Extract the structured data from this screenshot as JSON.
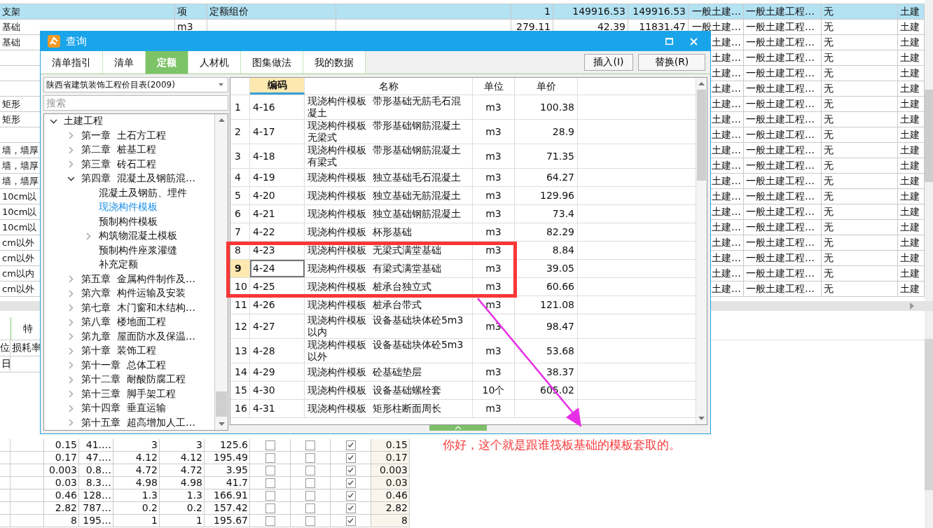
{
  "sheet": {
    "rows": [
      {
        "selected": true,
        "desc": "支架",
        "unit": "项",
        "name": "定额组价",
        "qty": "1",
        "price": "149916.53",
        "total": "149916.53",
        "c1": "一般土建…",
        "c2": "一般土建工程…",
        "c3": "无",
        "c4": "土建"
      },
      {
        "selected": false,
        "desc": "基础",
        "unit": "m3",
        "qty": "279.11",
        "price": "42.39",
        "total": "11831.47",
        "c1": "一般土建…",
        "c2": "一般土建工程…",
        "c3": "无",
        "c4": "土建"
      },
      {
        "selected": false,
        "desc": "基础",
        "c1": "土建…",
        "c2": "一般土建工程…",
        "c3": "无",
        "c4": "土建"
      },
      {
        "selected": false,
        "c1": "土建…",
        "c2": "一般土建工程…",
        "c3": "无",
        "c4": "土建"
      },
      {
        "selected": false,
        "c1": "土建…",
        "c2": "一般土建工程…",
        "c3": "无",
        "c4": "土建"
      },
      {
        "selected": false,
        "c1": "土建…",
        "c2": "一般土建工程…",
        "c3": "无",
        "c4": "土建"
      },
      {
        "selected": false,
        "desc": "矩形",
        "c1": "土建…",
        "c2": "一般土建工程…",
        "c3": "无",
        "c4": "土建"
      },
      {
        "selected": false,
        "desc": "矩形",
        "c1": "土建…",
        "c2": "一般土建工程…",
        "c3": "无",
        "c4": "土建"
      },
      {
        "selected": false,
        "c1": "土建…",
        "c2": "一般土建工程…",
        "c3": "无",
        "c4": "土建"
      },
      {
        "selected": false,
        "desc": "墙，墙厚",
        "c1": "土建…",
        "c2": "一般土建工程…",
        "c3": "无",
        "c4": "土建"
      },
      {
        "selected": false,
        "desc": "墙，墙厚",
        "c1": "土建…",
        "c2": "一般土建工程…",
        "c3": "无",
        "c4": "土建"
      },
      {
        "selected": false,
        "desc": "墙，墙厚",
        "c1": "土建…",
        "c2": "一般土建工程…",
        "c3": "无",
        "c4": "土建"
      },
      {
        "selected": false,
        "desc": "10cm以",
        "c1": "土建…",
        "c2": "一般土建工程…",
        "c3": "无",
        "c4": "土建"
      },
      {
        "selected": false,
        "desc": "10cm以",
        "c1": "土建…",
        "c2": "一般土建工程…",
        "c3": "无",
        "c4": "土建"
      },
      {
        "selected": false,
        "desc": "10cm以",
        "c1": "土建…",
        "c2": "一般土建工程…",
        "c3": "无",
        "c4": "土建"
      },
      {
        "selected": false,
        "desc": "cm以外",
        "c1": "土建…",
        "c2": "一般土建工程…",
        "c3": "无",
        "c4": "土建"
      },
      {
        "selected": false,
        "desc": "cm以外",
        "c1": "土建…",
        "c2": "一般土建工程…",
        "c3": "无",
        "c4": "土建"
      },
      {
        "selected": false,
        "desc": "cm以内",
        "c1": "土建…",
        "c2": "一般土建工程…",
        "c3": "无",
        "c4": "土建"
      },
      {
        "selected": false,
        "desc": "cm以外",
        "c1": "土建…",
        "c2": "一般土建工程…",
        "c3": "无",
        "c4": "土建"
      }
    ]
  },
  "lower": {
    "tab": "特",
    "headers": [
      "位",
      "损耗率"
    ],
    "first_row": "日",
    "rows": [
      {
        "column_3": "0.15",
        "column_4": "41.…",
        "column_5": "3",
        "column_6": "3",
        "column_7": "125.6",
        "check_1": false,
        "check_2": false,
        "check_3": true,
        "column_11": "0.15"
      },
      {
        "column_3": "0.17",
        "column_4": "47.…",
        "column_5": "4.12",
        "column_6": "4.12",
        "column_7": "195.49",
        "check_1": false,
        "check_2": false,
        "check_3": true,
        "column_11": "0.17"
      },
      {
        "column_3": "0.003",
        "column_4": "0.8…",
        "column_5": "4.72",
        "column_6": "4.72",
        "column_7": "3.95",
        "check_1": false,
        "check_2": false,
        "check_3": true,
        "column_11": "0.003"
      },
      {
        "column_3": "0.03",
        "column_4": "8.3…",
        "column_5": "4.98",
        "column_6": "4.98",
        "column_7": "41.7",
        "check_1": false,
        "check_2": false,
        "check_3": true,
        "column_11": "0.03"
      },
      {
        "column_3": "0.46",
        "column_4": "128…",
        "column_5": "1.3",
        "column_6": "1.3",
        "column_7": "166.91",
        "check_1": false,
        "check_2": false,
        "check_3": true,
        "column_11": "0.46"
      },
      {
        "column_3": "2.82",
        "column_4": "787…",
        "column_5": "0.2",
        "column_6": "0.2",
        "column_7": "157.42",
        "check_1": false,
        "check_2": false,
        "check_3": true,
        "column_11": "2.82"
      },
      {
        "column_3": "8",
        "column_4": "195…",
        "column_5": "1",
        "column_6": "1",
        "column_7": "195.67",
        "check_1": false,
        "check_2": false,
        "check_3": true,
        "column_11": "8"
      }
    ]
  },
  "dialog": {
    "title": "查询",
    "tabs": [
      {
        "label": "清单指引",
        "selected": false
      },
      {
        "label": "清单",
        "selected": false
      },
      {
        "label": "定额",
        "selected": true
      },
      {
        "label": "人材机",
        "selected": false
      },
      {
        "label": "图集做法",
        "selected": false
      },
      {
        "label": "我的数据",
        "selected": false
      }
    ],
    "buttons": [
      "插入(I)",
      "替换(R)"
    ],
    "library": "陕西省建筑装饰工程价目表(2009)",
    "search": {
      "placeholder": "搜索"
    },
    "tree": [
      {
        "label": "土建工程",
        "kind": "branch",
        "expanded": true,
        "selected": false,
        "children": [
          {
            "label": "第一章  土石方工程",
            "kind": "branch",
            "expanded": false,
            "selected": false
          },
          {
            "label": "第二章  桩基工程",
            "kind": "branch",
            "expanded": false,
            "selected": false
          },
          {
            "label": "第三章  砖石工程",
            "kind": "branch",
            "expanded": false,
            "selected": false
          },
          {
            "label": "第四章  混凝土及钢筋混…",
            "kind": "branch",
            "expanded": true,
            "selected": false,
            "children": [
              {
                "label": "混凝土及钢筋、埋件",
                "kind": "leaf",
                "selected": false
              },
              {
                "label": "现浇构件模板",
                "kind": "leaf",
                "selected": true
              },
              {
                "label": "预制构件模板",
                "kind": "leaf",
                "selected": false
              },
              {
                "label": "构筑物混凝土模板",
                "kind": "branch",
                "expanded": false,
                "selected": false
              },
              {
                "label": "预制构件座浆灌缝",
                "kind": "leaf",
                "selected": false
              },
              {
                "label": "补充定额",
                "kind": "leaf",
                "selected": false
              }
            ]
          },
          {
            "label": "第五章  金属构件制作及…",
            "kind": "branch",
            "expanded": false,
            "selected": false
          },
          {
            "label": "第六章  构件运输及安装",
            "kind": "branch",
            "expanded": false,
            "selected": false
          },
          {
            "label": "第七章  木门窗和木结构…",
            "kind": "branch",
            "expanded": false,
            "selected": false
          },
          {
            "label": "第八章  楼地面工程",
            "kind": "branch",
            "expanded": false,
            "selected": false
          },
          {
            "label": "第九章  屋面防水及保温…",
            "kind": "branch",
            "expanded": false,
            "selected": false
          },
          {
            "label": "第十章  装饰工程",
            "kind": "branch",
            "expanded": false,
            "selected": false
          },
          {
            "label": "第十一章  总体工程",
            "kind": "branch",
            "expanded": false,
            "selected": false
          },
          {
            "label": "第十二章  耐酸防腐工程",
            "kind": "branch",
            "expanded": false,
            "selected": false
          },
          {
            "label": "第十三章  脚手架工程",
            "kind": "branch",
            "expanded": false,
            "selected": false
          },
          {
            "label": "第十四章  垂直运输",
            "kind": "branch",
            "expanded": false,
            "selected": false
          },
          {
            "label": "第十五章  超高增加人工…",
            "kind": "branch",
            "expanded": false,
            "selected": false
          }
        ]
      }
    ],
    "table": {
      "columns": [
        "编码",
        "名称",
        "单位",
        "单价"
      ],
      "rows": [
        {
          "num": "1",
          "code": "4-16",
          "name": "现浇构件模板  带形基础无筋毛石混凝土",
          "unit": "m3",
          "price": "100.38",
          "selected": false
        },
        {
          "num": "2",
          "code": "4-17",
          "name": "现浇构件模板  带形基础钢筋混凝土无梁式",
          "unit": "m3",
          "price": "28.9",
          "selected": false
        },
        {
          "num": "3",
          "code": "4-18",
          "name": "现浇构件模板  带形基础钢筋混凝土有梁式",
          "unit": "m3",
          "price": "71.35",
          "selected": false
        },
        {
          "num": "4",
          "code": "4-19",
          "name": "现浇构件模板  独立基础毛石混凝土",
          "unit": "m3",
          "price": "64.27",
          "selected": false
        },
        {
          "num": "5",
          "code": "4-20",
          "name": "现浇构件模板  独立基础无筋混凝土",
          "unit": "m3",
          "price": "129.96",
          "selected": false
        },
        {
          "num": "6",
          "code": "4-21",
          "name": "现浇构件模板  独立基础钢筋混凝土",
          "unit": "m3",
          "price": "73.4",
          "selected": false
        },
        {
          "num": "7",
          "code": "4-22",
          "name": "现浇构件模板  杯形基础",
          "unit": "m3",
          "price": "82.29",
          "selected": false
        },
        {
          "num": "8",
          "code": "4-23",
          "name": "现浇构件模板  无梁式满堂基础",
          "unit": "m3",
          "price": "8.84",
          "selected": false
        },
        {
          "num": "9",
          "code": "4-24",
          "name": "现浇构件模板  有梁式满堂基础",
          "unit": "m3",
          "price": "39.05",
          "selected": true
        },
        {
          "num": "10",
          "code": "4-25",
          "name": "现浇构件模板  桩承台独立式",
          "unit": "m3",
          "price": "60.66",
          "selected": false
        },
        {
          "num": "11",
          "code": "4-26",
          "name": "现浇构件模板  桩承台带式",
          "unit": "m3",
          "price": "121.08",
          "selected": false
        },
        {
          "num": "12",
          "code": "4-27",
          "name": "现浇构件模板  设备基础块体砼5m3以内",
          "unit": "m3",
          "price": "98.47",
          "selected": false
        },
        {
          "num": "13",
          "code": "4-28",
          "name": "现浇构件模板  设备基础块体砼5m3以外",
          "unit": "m3",
          "price": "53.68",
          "selected": false
        },
        {
          "num": "14",
          "code": "4-29",
          "name": "现浇构件模板  砼基础垫层",
          "unit": "m3",
          "price": "38.37",
          "selected": false
        },
        {
          "num": "15",
          "code": "4-30",
          "name": "现浇构件模板  设备基础螺栓套",
          "unit": "10个",
          "price": "605.02",
          "selected": false
        },
        {
          "num": "16",
          "code": "4-31",
          "name": "现浇构件模板  矩形柱断面周长",
          "unit": "m3",
          "selected": false
        }
      ]
    }
  },
  "annotation": {
    "note": "你好，这个就是跟谁筏板基础的模板套取的。"
  }
}
